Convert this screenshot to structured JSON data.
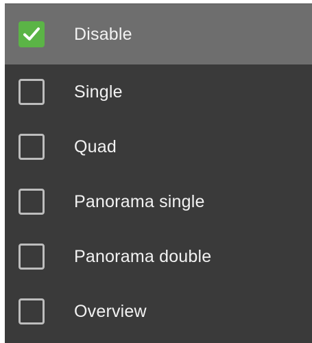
{
  "menu": {
    "items": [
      {
        "label": "Disable",
        "checked": true
      },
      {
        "label": "Single",
        "checked": false
      },
      {
        "label": "Quad",
        "checked": false
      },
      {
        "label": "Panorama single",
        "checked": false
      },
      {
        "label": "Panorama double",
        "checked": false
      },
      {
        "label": "Overview",
        "checked": false
      }
    ]
  },
  "colors": {
    "menu_bg": "#3a3a3a",
    "selected_bg": "#6e6e6e",
    "check_green": "#5bb446",
    "checkbox_border": "#bdbdbd",
    "text": "#f2f2f2"
  },
  "icons": {
    "check": "checkmark-icon"
  }
}
